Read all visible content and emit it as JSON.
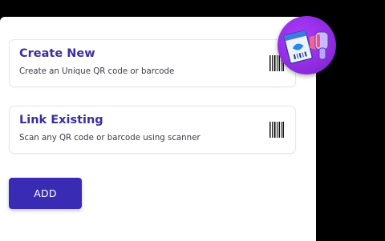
{
  "options": [
    {
      "title": "Create New",
      "subtitle": "Create an Unique QR code or barcode",
      "icon": "barcode-icon"
    },
    {
      "title": "Link Existing",
      "subtitle": "Scan any QR code or barcode using scanner",
      "icon": "barcode-icon"
    }
  ],
  "add_button": {
    "label": "ADD"
  },
  "badge": {
    "icon": "barcode-scanner-icon"
  },
  "colors": {
    "accent": "#3a2bb5",
    "title": "#3a2f9e",
    "badge": "#9b2ff0",
    "background": "#000000"
  }
}
